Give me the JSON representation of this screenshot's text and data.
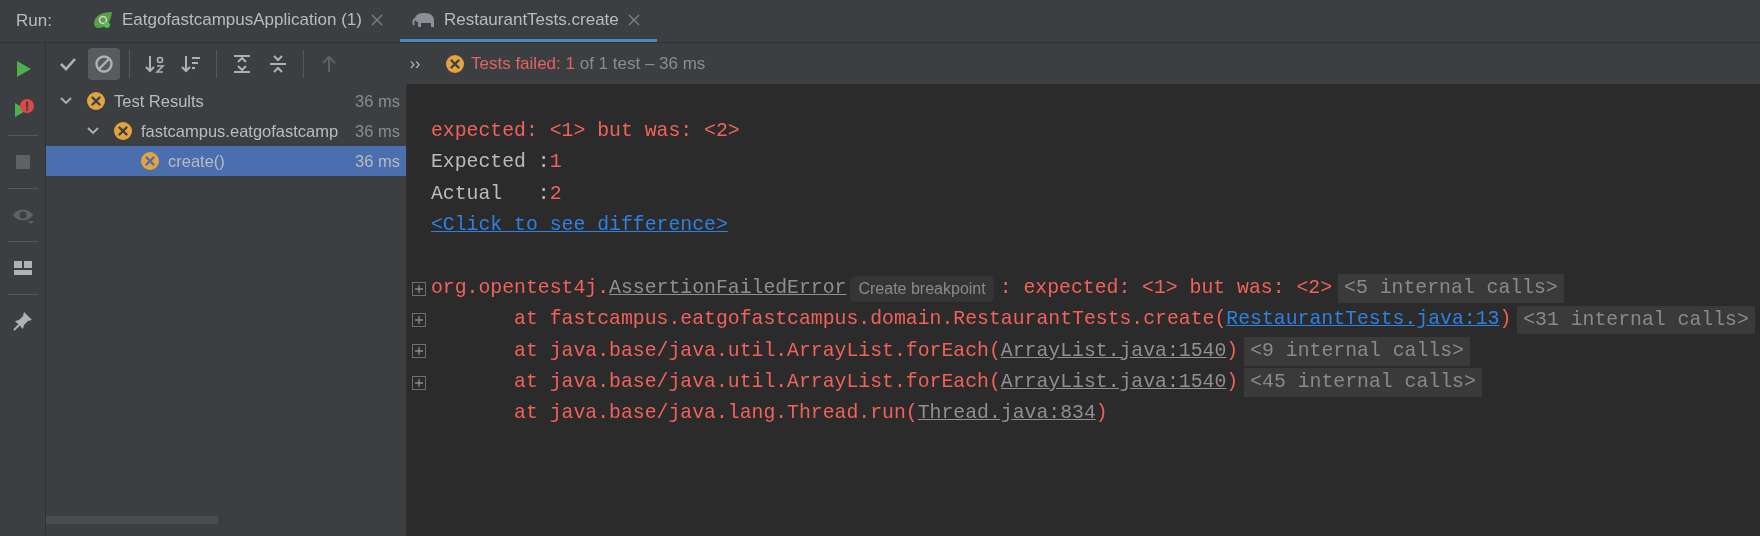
{
  "run_label": "Run:",
  "tabs": [
    {
      "label": "EatgofastcampusApplication (1)",
      "kind": "spring",
      "selected": false
    },
    {
      "label": "RestaurantTests.create",
      "kind": "test",
      "selected": true
    }
  ],
  "side_toolbar": [
    [
      {
        "kind": "run",
        "disabled": false
      },
      {
        "kind": "rerun_failed",
        "disabled": false
      }
    ],
    [
      {
        "kind": "stop",
        "disabled": true
      }
    ],
    [
      {
        "kind": "view",
        "disabled": true
      }
    ],
    [
      {
        "kind": "layout",
        "disabled": false
      }
    ],
    [
      {
        "kind": "pin",
        "disabled": false
      }
    ]
  ],
  "toolbar": [
    [
      {
        "kind": "show_passed",
        "selected": false,
        "disabled": false
      },
      {
        "kind": "show_ignored",
        "selected": true,
        "disabled": false
      }
    ],
    [
      {
        "kind": "sort_alpha",
        "selected": false,
        "disabled": false
      },
      {
        "kind": "sort_duration",
        "selected": false,
        "disabled": false
      }
    ],
    [
      {
        "kind": "expand_all",
        "selected": false,
        "disabled": false
      },
      {
        "kind": "collapse_all",
        "selected": false,
        "disabled": false
      }
    ],
    [
      {
        "kind": "previous",
        "selected": false,
        "disabled": true
      }
    ]
  ],
  "overflow": "››",
  "status": {
    "failed": "Tests failed: 1",
    "summary": "of 1 test – 36 ms"
  },
  "tree": [
    {
      "label": "Test Results",
      "time": "36 ms",
      "expanded": true,
      "selected": false,
      "children": [
        {
          "label": "fastcampus.eatgofastcamp",
          "time": "36 ms",
          "expanded": true,
          "selected": false,
          "children": [
            {
              "label": "create()",
              "time": "36 ms",
              "selected": true
            }
          ]
        }
      ]
    }
  ],
  "console": [
    {
      "kind": "message",
      "foldable": false,
      "segments": [
        {
          "kind": "error",
          "text": "expected: <1> but was: <2>"
        }
      ]
    },
    {
      "kind": "message",
      "foldable": false,
      "segments": [
        {
          "kind": "plain",
          "text": "Expected :"
        },
        {
          "kind": "error",
          "text": "1"
        }
      ]
    },
    {
      "kind": "message",
      "foldable": false,
      "segments": [
        {
          "kind": "plain",
          "text": "Actual   :"
        },
        {
          "kind": "error",
          "text": "2"
        }
      ]
    },
    {
      "kind": "message",
      "foldable": false,
      "segments": [
        {
          "kind": "link",
          "text": "<Click to see difference>"
        }
      ]
    },
    {
      "kind": "exception",
      "foldable": true,
      "segments": [
        {
          "kind": "error",
          "text": "org.opentest4j."
        },
        {
          "kind": "source_link",
          "text": "AssertionFailedError"
        },
        {
          "kind": "hint",
          "text": "Create breakpoint"
        },
        {
          "kind": "error",
          "text": ": expected: <1> but was: <2>"
        },
        {
          "kind": "folded",
          "text": "<5 internal calls>"
        }
      ]
    },
    {
      "kind": "frame",
      "foldable": true,
      "segments": [
        {
          "kind": "error",
          "text": "at fastcampus.eatgofastcampus.domain.RestaurantTests.create("
        },
        {
          "kind": "link",
          "text": "RestaurantTests.java:13"
        },
        {
          "kind": "error",
          "text": ")"
        },
        {
          "kind": "folded",
          "text": "<31 internal calls>"
        }
      ]
    },
    {
      "kind": "frame",
      "foldable": true,
      "segments": [
        {
          "kind": "error",
          "text": "at java.base/java.util.ArrayList.forEach("
        },
        {
          "kind": "source_link",
          "text": "ArrayList.java:1540"
        },
        {
          "kind": "error",
          "text": ")"
        },
        {
          "kind": "folded",
          "text": "<9 internal calls>"
        }
      ]
    },
    {
      "kind": "frame",
      "foldable": true,
      "segments": [
        {
          "kind": "error",
          "text": "at java.base/java.util.ArrayList.forEach("
        },
        {
          "kind": "source_link",
          "text": "ArrayList.java:1540"
        },
        {
          "kind": "error",
          "text": ")"
        },
        {
          "kind": "folded",
          "text": "<45 internal calls>"
        }
      ]
    },
    {
      "kind": "frame",
      "foldable": false,
      "segments": [
        {
          "kind": "error",
          "text": "at java.base/java.lang.Thread.run("
        },
        {
          "kind": "source_link",
          "text": "Thread.java:834"
        },
        {
          "kind": "error",
          "text": ")"
        }
      ]
    }
  ]
}
